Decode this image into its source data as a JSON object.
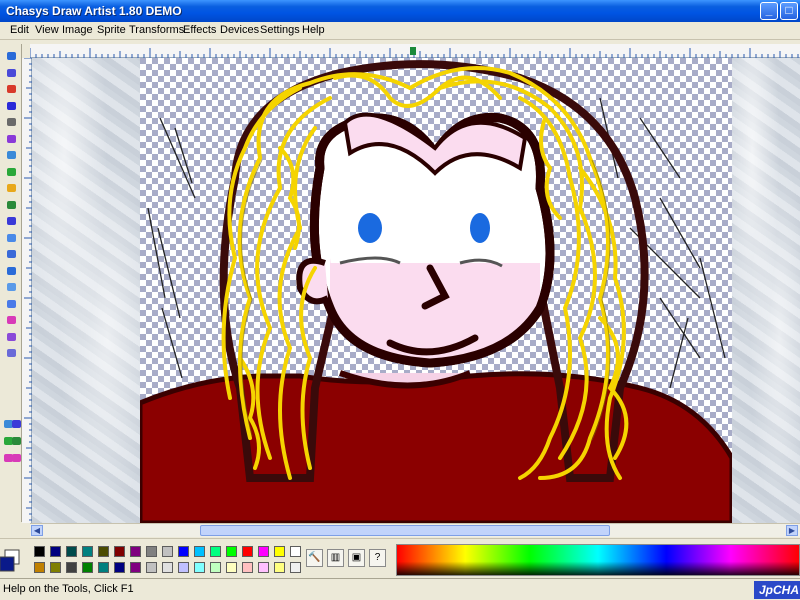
{
  "window": {
    "title": "Chasys Draw Artist 1.80 DEMO",
    "minimize": "_",
    "maximize": "□"
  },
  "menu": [
    "Edit",
    "View",
    "Image",
    "Sprite",
    "Transforms",
    "Effects",
    "Devices",
    "Settings",
    "Help"
  ],
  "tools": [
    {
      "icon": "pencil-icon",
      "color": "#2a6bd8"
    },
    {
      "icon": "brush-icon",
      "color": "#4a4ad8"
    },
    {
      "icon": "spray-icon",
      "color": "#d83a2a"
    },
    {
      "icon": "wave-line-icon",
      "color": "#2a2ad8"
    },
    {
      "icon": "line-icon",
      "color": "#6a6a6a"
    },
    {
      "icon": "triangle-icon",
      "color": "#8a3ad8"
    },
    {
      "icon": "magnifier-icon",
      "color": "#3a8ad8"
    },
    {
      "icon": "select-icon",
      "color": "#2aa83a"
    },
    {
      "icon": "fill-icon",
      "color": "#e8a81a"
    },
    {
      "icon": "text-icon",
      "color": "#2a8a3a"
    },
    {
      "icon": "circle-icon",
      "color": "#3a3ad8"
    },
    {
      "icon": "ellipse-icon",
      "color": "#4a8ae8"
    },
    {
      "icon": "polygon-icon",
      "color": "#3a6ad8"
    },
    {
      "icon": "rectangle-icon",
      "color": "#2a6bd8"
    },
    {
      "icon": "rounded-rect-icon",
      "color": "#5a9ae8"
    },
    {
      "icon": "rectangle-outline-icon",
      "color": "#4a7ae8"
    },
    {
      "icon": "eyedropper-icon",
      "color": "#d83ab8"
    },
    {
      "icon": "smudge-icon",
      "color": "#8a4ad8"
    },
    {
      "icon": "eraser-icon",
      "color": "#6a6ad8"
    }
  ],
  "file_tools": [
    {
      "icon": "new-icon",
      "color": "#3a8ad8"
    },
    {
      "icon": "save-icon",
      "color": "#3a3ad8"
    },
    {
      "icon": "image-icon",
      "color": "#2aa83a"
    },
    {
      "icon": "layers-icon",
      "color": "#2a8a3a"
    },
    {
      "icon": "arrow-left-icon",
      "color": "#d83ab8"
    },
    {
      "icon": "arrow-right-icon",
      "color": "#d83ab8"
    }
  ],
  "palette_row1": [
    "#000000",
    "#00007f",
    "#004b4b",
    "#008080",
    "#4b4b00",
    "#7f0000",
    "#7f007f",
    "#808080",
    "#c0c0c0",
    "#0000ff",
    "#00c0ff",
    "#00ff80",
    "#00ff00",
    "#ff0000",
    "#ff00ff",
    "#ffff00",
    "#ffffff"
  ],
  "palette_row2": [
    "#c08000",
    "#7f7f00",
    "#404040",
    "#008000",
    "#007f7f",
    "#000080",
    "#800080",
    "#c0c0c0",
    "#e0e0e0",
    "#c0c0ff",
    "#80ffff",
    "#c0ffc0",
    "#ffffc0",
    "#ffc0c0",
    "#ffc0ff",
    "#ffff80",
    "#f0f0f0"
  ],
  "palette_tools": [
    "hammer-icon",
    "palette-bars-icon",
    "picture-icon",
    "help-icon"
  ],
  "palette_tool_glyphs": [
    "🔨",
    "▥",
    "▣",
    "?"
  ],
  "current_colors": {
    "foreground": "#0a1a8a",
    "background": "#ffffff"
  },
  "status": {
    "text": "Help on the Tools, Click F1",
    "brand": "JpCHA"
  },
  "scroll": {
    "left_arrow": "◀",
    "right_arrow": "▶"
  }
}
